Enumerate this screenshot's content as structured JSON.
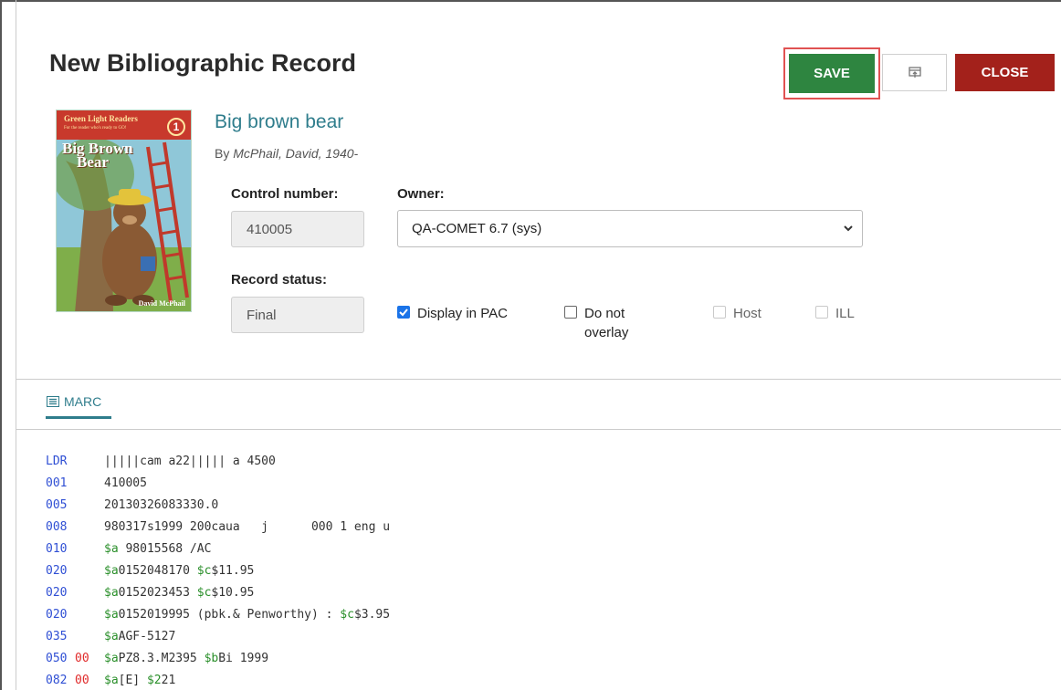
{
  "header": {
    "title": "New Bibliographic Record",
    "save_label": "SAVE",
    "close_label": "CLOSE"
  },
  "cover": {
    "series": "Green Light Readers",
    "series_sub": "For the reader who's ready to GO!",
    "level": "1",
    "title_line1": "Big Brown",
    "title_line2": "Bear",
    "author": "David McPhail"
  },
  "record": {
    "title": "Big brown bear",
    "by_prefix": "By",
    "author": "McPhail, David, 1940-",
    "control_number_label": "Control number:",
    "control_number": "410005",
    "owner_label": "Owner:",
    "owner": "QA-COMET 6.7 (sys)",
    "status_label": "Record status:",
    "status": "Final",
    "checks": {
      "display_pac": "Display in PAC",
      "no_overlay_1": "Do not",
      "no_overlay_2": "overlay",
      "host": "Host",
      "ill": "ILL"
    }
  },
  "tab": {
    "label": "MARC"
  },
  "marc": [
    {
      "tag": "LDR",
      "ind": "",
      "value": "|||||cam a22||||| a 4500"
    },
    {
      "tag": "001",
      "ind": "",
      "value": "410005"
    },
    {
      "tag": "005",
      "ind": "",
      "value": "20130326083330.0"
    },
    {
      "tag": "008",
      "ind": "",
      "value": "980317s1999 200caua   j      000 1 eng u"
    },
    {
      "tag": "010",
      "ind": "",
      "parts": [
        [
          "$a",
          " 98015568 /AC"
        ]
      ]
    },
    {
      "tag": "020",
      "ind": "",
      "parts": [
        [
          "$a",
          "0152048170 "
        ],
        [
          "$c",
          "$11.95"
        ]
      ]
    },
    {
      "tag": "020",
      "ind": "",
      "parts": [
        [
          "$a",
          "0152023453 "
        ],
        [
          "$c",
          "$10.95"
        ]
      ]
    },
    {
      "tag": "020",
      "ind": "",
      "parts": [
        [
          "$a",
          "0152019995 (pbk.& Penworthy) : "
        ],
        [
          "$c",
          "$3.95"
        ]
      ]
    },
    {
      "tag": "035",
      "ind": "",
      "parts": [
        [
          "$a",
          "AGF-5127"
        ]
      ]
    },
    {
      "tag": "050",
      "ind": "00",
      "parts": [
        [
          "$a",
          "PZ8.3.M2395 "
        ],
        [
          "$b",
          "Bi 1999"
        ]
      ]
    },
    {
      "tag": "082",
      "ind": "00",
      "parts": [
        [
          "$a",
          "[E] "
        ],
        [
          "$2",
          "21"
        ]
      ]
    }
  ]
}
